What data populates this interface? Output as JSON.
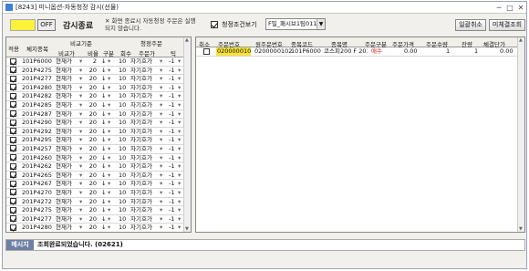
{
  "window": {
    "title": "[8243] 미니옵션-자동청정 감시(선물)",
    "min": "─",
    "max": "□",
    "close": "✕"
  },
  "toolbar": {
    "off_label": "OFF",
    "status_text": "감시종료",
    "warning_text": "✕ 화면 종료시 자동청정 주문은 실행되지 않습니다.",
    "cond_label": "청정조건보기",
    "account": "F밀_패시브1팀0113",
    "dropdown_arrow": "▼",
    "cancel_btn": "일괄취소",
    "unfilled_btn": "미체결조회"
  },
  "left": {
    "headers": {
      "select": "적용",
      "code": "체지종목",
      "compare_group": "비교기준",
      "compare_price": "비교가",
      "ratio": "비율",
      "type": "구분",
      "count": "회수",
      "clear_group": "청정주문",
      "order_price": "주문가",
      "tick": "틱"
    },
    "rows": [
      {
        "code": "101P6000",
        "price": "현재가",
        "ratio": "2",
        "type": "↓",
        "count": "10",
        "order": "자기호가",
        "tick": "-1"
      },
      {
        "code": "201P4275",
        "price": "현재가",
        "ratio": "20",
        "type": "↓",
        "count": "10",
        "order": "자기호가",
        "tick": "-1"
      },
      {
        "code": "201P4277",
        "price": "현재가",
        "ratio": "20",
        "type": "↓",
        "count": "10",
        "order": "자기호가",
        "tick": "-1"
      },
      {
        "code": "201P4280",
        "price": "현재가",
        "ratio": "20",
        "type": "↓",
        "count": "10",
        "order": "자기호가",
        "tick": "-1"
      },
      {
        "code": "201P4282",
        "price": "현재가",
        "ratio": "20",
        "type": "↓",
        "count": "10",
        "order": "자기호가",
        "tick": "-1"
      },
      {
        "code": "201P4285",
        "price": "현재가",
        "ratio": "20",
        "type": "↓",
        "count": "10",
        "order": "자기호가",
        "tick": "-1"
      },
      {
        "code": "201P4287",
        "price": "현재가",
        "ratio": "20",
        "type": "↓",
        "count": "10",
        "order": "자기호가",
        "tick": "-1"
      },
      {
        "code": "201P4290",
        "price": "현재가",
        "ratio": "20",
        "type": "↓",
        "count": "10",
        "order": "자기호가",
        "tick": "-1"
      },
      {
        "code": "201P4292",
        "price": "현재가",
        "ratio": "20",
        "type": "↓",
        "count": "10",
        "order": "자기호가",
        "tick": "-1"
      },
      {
        "code": "201P4295",
        "price": "현재가",
        "ratio": "20",
        "type": "↓",
        "count": "10",
        "order": "자기호가",
        "tick": "-1"
      },
      {
        "code": "201P4257",
        "price": "현재가",
        "ratio": "20",
        "type": "↓",
        "count": "10",
        "order": "자기호가",
        "tick": "-1"
      },
      {
        "code": "201P4260",
        "price": "현재가",
        "ratio": "20",
        "type": "↓",
        "count": "10",
        "order": "자기호가",
        "tick": "-1"
      },
      {
        "code": "201P4262",
        "price": "현재가",
        "ratio": "20",
        "type": "↓",
        "count": "10",
        "order": "자기호가",
        "tick": "-1"
      },
      {
        "code": "201P4265",
        "price": "현재가",
        "ratio": "20",
        "type": "↓",
        "count": "10",
        "order": "자기호가",
        "tick": "-1"
      },
      {
        "code": "201P4267",
        "price": "현재가",
        "ratio": "20",
        "type": "↓",
        "count": "10",
        "order": "자기호가",
        "tick": "-1"
      },
      {
        "code": "201P4270",
        "price": "현재가",
        "ratio": "20",
        "type": "↓",
        "count": "10",
        "order": "자기호가",
        "tick": "-1"
      },
      {
        "code": "201P4272",
        "price": "현재가",
        "ratio": "20",
        "type": "↓",
        "count": "10",
        "order": "자기호가",
        "tick": "-1"
      },
      {
        "code": "201P4275",
        "price": "현재가",
        "ratio": "20",
        "type": "↓",
        "count": "10",
        "order": "자기호가",
        "tick": "-1"
      },
      {
        "code": "201P4277",
        "price": "현재가",
        "ratio": "20",
        "type": "↓",
        "count": "10",
        "order": "자기호가",
        "tick": "-1"
      },
      {
        "code": "201P4280",
        "price": "현재가",
        "ratio": "20",
        "type": "↓",
        "count": "10",
        "order": "자기호가",
        "tick": "-1"
      }
    ]
  },
  "right": {
    "headers": {
      "cancel": "취소",
      "order_no": "주문번호",
      "orig_no": "원주문번호",
      "code": "종목코드",
      "name": "종목명",
      "side": "주문구분",
      "price": "주문가격",
      "qty": "주문수량",
      "remain": "잔량",
      "avg": "체결단가"
    },
    "row": {
      "order_no": "0200000103",
      "orig_no": "0200000102",
      "code": "101P6000",
      "name": "코스피200 F 201906",
      "side": "매수",
      "price": "0.00",
      "qty": "1",
      "remain": "1",
      "avg": "0.00"
    }
  },
  "message": {
    "label": "메시지",
    "text": "조회완료되었습니다. (02621)"
  },
  "colors": {
    "status_yellow": "#fff23a",
    "selected_cell": "#f7e23a",
    "buy_red": "#d42020",
    "msg_label_bg": "#6e7fa3"
  }
}
